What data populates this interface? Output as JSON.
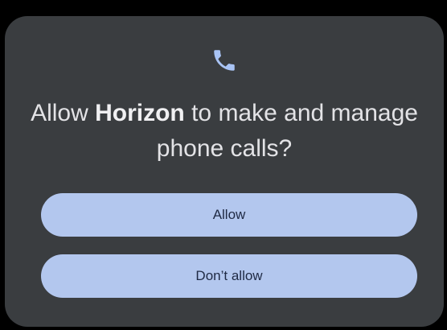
{
  "dialog": {
    "icon": "phone-icon",
    "title_prefix": "Allow ",
    "app_name": "Horizon",
    "title_suffix": " to make and manage phone calls?",
    "allow_label": "Allow",
    "deny_label": "Don’t allow"
  },
  "colors": {
    "background": "#000000",
    "dialog_bg": "#3a3d40",
    "icon": "#a9c4f5",
    "title_text": "#e3e3e6",
    "button_bg": "#b3c7ee",
    "button_text": "#1f2a44"
  }
}
